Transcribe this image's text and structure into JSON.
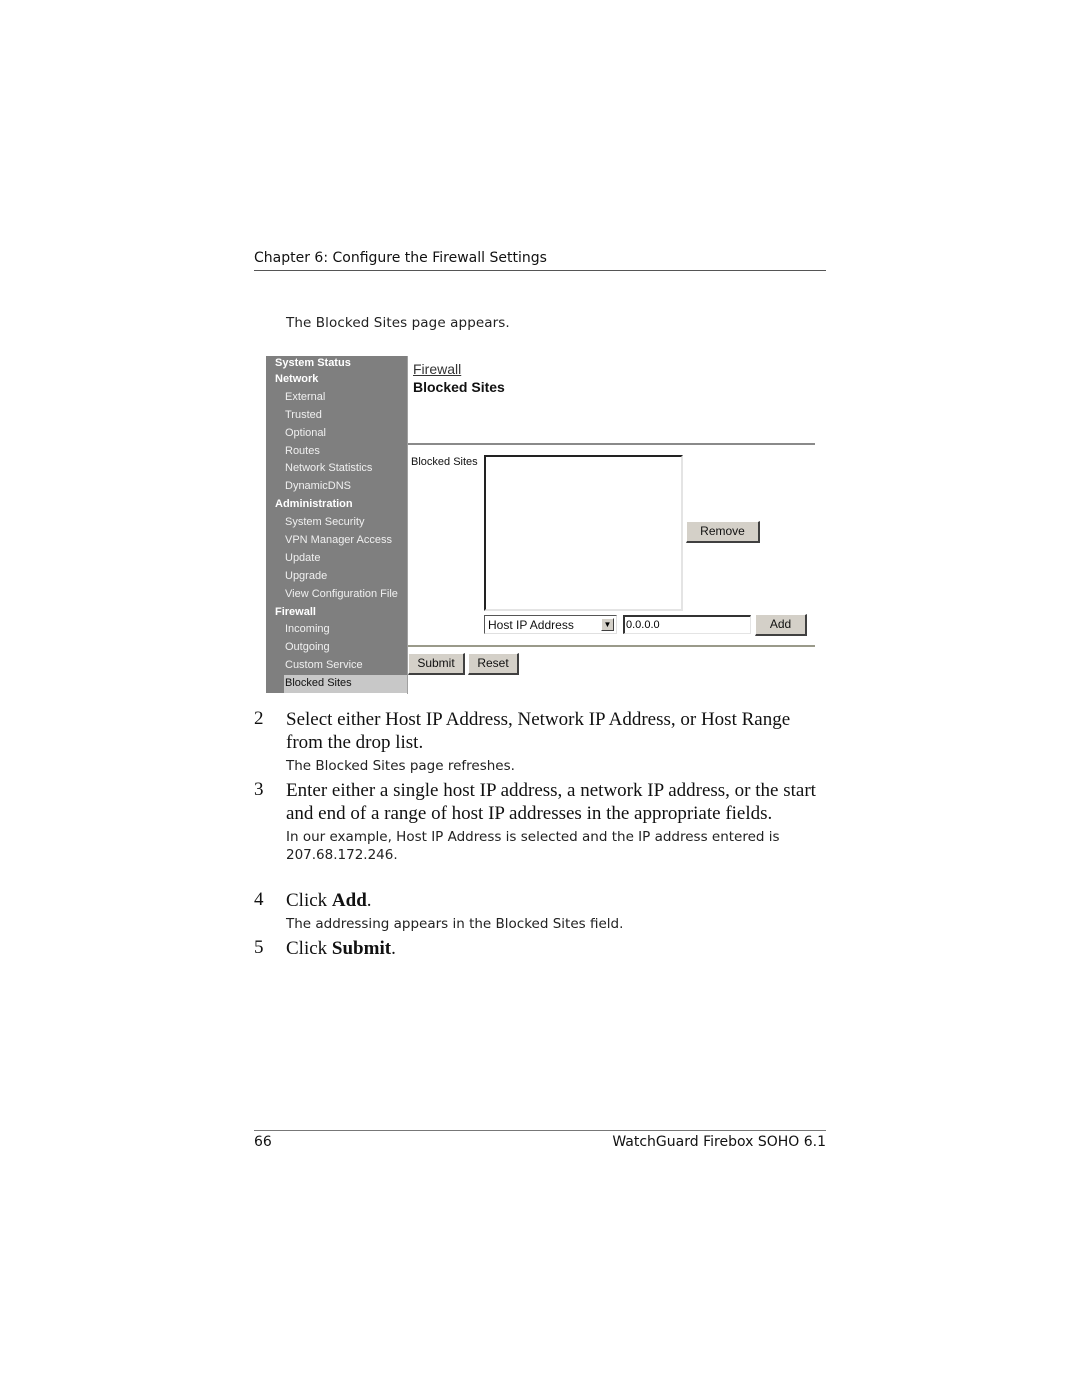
{
  "header": {
    "chapter": "Chapter 6: Configure the Firewall Settings"
  },
  "intro_note": "The Blocked Sites page appears.",
  "screenshot": {
    "sidebar": {
      "items": [
        {
          "label": "System Status",
          "type": "section"
        },
        {
          "label": "Network",
          "type": "section"
        },
        {
          "label": "External",
          "type": "item"
        },
        {
          "label": "Trusted",
          "type": "item"
        },
        {
          "label": "Optional",
          "type": "item"
        },
        {
          "label": "Routes",
          "type": "item"
        },
        {
          "label": "Network Statistics",
          "type": "item"
        },
        {
          "label": "DynamicDNS",
          "type": "item"
        },
        {
          "label": "Administration",
          "type": "section"
        },
        {
          "label": "System Security",
          "type": "item"
        },
        {
          "label": "VPN Manager Access",
          "type": "item"
        },
        {
          "label": "Update",
          "type": "item"
        },
        {
          "label": "Upgrade",
          "type": "item"
        },
        {
          "label": "View Configuration File",
          "type": "item"
        },
        {
          "label": "Firewall",
          "type": "section"
        },
        {
          "label": "Incoming",
          "type": "item"
        },
        {
          "label": "Outgoing",
          "type": "item"
        },
        {
          "label": "Custom Service",
          "type": "item"
        },
        {
          "label": "Blocked Sites",
          "type": "item",
          "selected": true
        }
      ]
    },
    "main": {
      "breadcrumb": "Firewall",
      "title": "Blocked Sites",
      "blocked_sites_label": "Blocked Sites",
      "blocked_sites_list": [],
      "remove_label": "Remove",
      "address_type_selected": "Host IP Address",
      "ip_value": "0.0.0.0",
      "add_label": "Add",
      "submit_label": "Submit",
      "reset_label": "Reset"
    }
  },
  "steps": [
    {
      "num": "2",
      "text": "Select either Host IP Address, Network IP Address, or Host Range from the drop list.",
      "note": "The Blocked Sites page refreshes."
    },
    {
      "num": "3",
      "text": "Enter either a single host IP address, a network IP address, or the start and end of a range of host IP addresses in the appropriate fields.",
      "note": "In our example, Host IP Address is selected and the IP address entered is 207.68.172.246."
    },
    {
      "num": "4",
      "text_prefix": "Click ",
      "text_bold": "Add",
      "text_suffix": ".",
      "note": "The addressing appears in the Blocked Sites field."
    },
    {
      "num": "5",
      "text_prefix": "Click ",
      "text_bold": "Submit",
      "text_suffix": "."
    }
  ],
  "footer": {
    "page_number": "66",
    "book_title": "WatchGuard Firebox SOHO 6.1"
  }
}
